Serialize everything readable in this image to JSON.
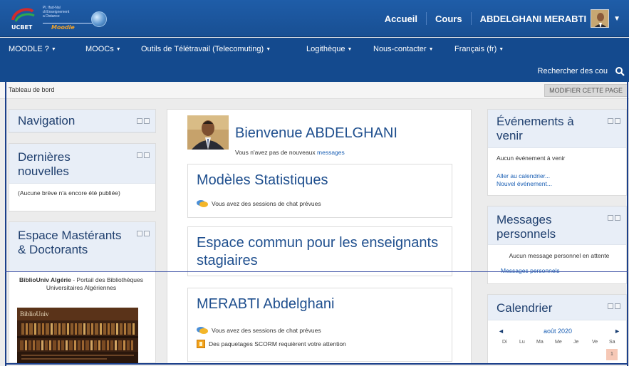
{
  "header": {
    "logo": {
      "org": "UCBET",
      "lines": [
        "Pl. Ifad-Nal",
        "di Enseignement",
        "a Distance"
      ],
      "brand": "Moodle"
    },
    "links": [
      {
        "label": "Accueil"
      },
      {
        "label": "Cours"
      }
    ],
    "user_name": "ABDELGHANI MERABTI"
  },
  "nav": {
    "items": [
      {
        "label": "MOODLE ?"
      },
      {
        "label": "MOOCs"
      },
      {
        "label": "Outils de Télétravail (Telecomuting)"
      },
      {
        "label": "Logithèque"
      },
      {
        "label": "Nous-contacter"
      },
      {
        "label": "Français (fr)"
      }
    ],
    "search_label": "Rechercher des cou"
  },
  "breadcrumb": {
    "label": "Tableau de bord"
  },
  "edit_button": "MODIFIER CETTE PAGE",
  "left": {
    "navigation": {
      "title": "Navigation"
    },
    "news": {
      "title": "Dernières nouvelles",
      "body": "(Aucune brève n'a encore été publiée)"
    },
    "espace": {
      "title": "Espace Mastérants & Doctorants"
    },
    "biblio": {
      "name": "BiblioUniv Algérie",
      "desc": " - Portail des Bibliothèques Universitaires Algériennes"
    }
  },
  "center": {
    "welcome": "Bienvenue ABDELGHANI",
    "no_messages_prefix": "Vous n'avez pas de nouveaux ",
    "no_messages_link": "messages",
    "courses": [
      {
        "title": "Modèles Statistiques",
        "notices": [
          "Vous avez des sessions de chat prévues"
        ]
      },
      {
        "title": "Espace commun pour les enseignants stagiaires",
        "notices": []
      },
      {
        "title": "MERABTI Abdelghani",
        "notices": [
          "Vous avez des sessions de chat prévues",
          "Des paquetages SCORM requièrent votre attention"
        ]
      }
    ]
  },
  "right": {
    "events": {
      "title": "Événements à venir",
      "empty": "Aucun événement à venir",
      "goto": "Aller au calendrier...",
      "new": "Nouvel événement..."
    },
    "messages": {
      "title": "Messages personnels",
      "empty": "Aucun message personnel en attente",
      "link": "Messages personnels"
    },
    "calendar": {
      "title": "Calendrier",
      "prev": "◄",
      "month": "août 2020",
      "next": "►",
      "days": [
        "Di",
        "Lu",
        "Ma",
        "Me",
        "Je",
        "Ve",
        "Sa"
      ],
      "first_day": "1"
    }
  },
  "colors": {
    "header": "#1f5da8",
    "nav": "#144a8e",
    "block_head": "#e8eef7",
    "title": "#1f4f8e"
  }
}
